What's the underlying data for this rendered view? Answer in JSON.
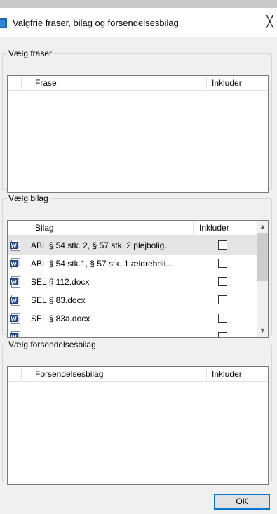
{
  "window": {
    "title": "Valgfrie fraser, bilag og forsendelsesbilag",
    "close_glyph": "╳"
  },
  "fraser": {
    "legend": "Vælg fraser",
    "col_name": "Frase",
    "col_include": "Inkluder",
    "rows": []
  },
  "bilag": {
    "legend": "Vælg bilag",
    "col_name": "Bilag",
    "col_include": "Inkluder",
    "rows": [
      {
        "name": "ABL § 54  stk. 2, § 57 stk. 2 plejbolig...",
        "checked": false,
        "selected": true
      },
      {
        "name": "ABL § 54 stk.1, § 57 stk. 1 ældreboli...",
        "checked": false,
        "selected": false
      },
      {
        "name": "SEL § 112.docx",
        "checked": false,
        "selected": false
      },
      {
        "name": "SEL § 83.docx",
        "checked": false,
        "selected": false
      },
      {
        "name": "SEL § 83a.docx",
        "checked": false,
        "selected": false
      }
    ],
    "scroll_up": "▲",
    "scroll_down": "▼"
  },
  "forsendelse": {
    "legend": "Vælg forsendelsesbilag",
    "col_name": "Forsendelsesbilag",
    "col_include": "Inkluder",
    "rows": []
  },
  "footer": {
    "ok_label": "OK"
  },
  "icons": {
    "title": "app-window-icon",
    "row": "word-document-icon",
    "close": "close-icon"
  },
  "colors": {
    "accent": "#0078d7",
    "selected_row": "#e5e5e5",
    "window_bg": "#f0f0f0"
  }
}
